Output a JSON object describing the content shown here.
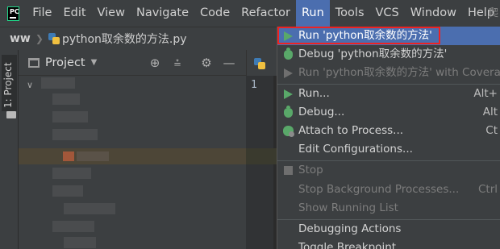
{
  "menubar": {
    "items": [
      "File",
      "Edit",
      "View",
      "Navigate",
      "Code",
      "Refactor",
      "Run",
      "Tools",
      "VCS",
      "Window",
      "Help"
    ],
    "active": "Run",
    "right_text": "爬"
  },
  "breadcrumb": {
    "project": "ww",
    "file": "python取余数的方法.py"
  },
  "left_strip": {
    "tab_label": "1: Project"
  },
  "project_pane": {
    "title": "Project"
  },
  "editor": {
    "line_number": "1"
  },
  "run_menu": {
    "items": [
      {
        "label": "Run 'python取余数的方法'",
        "shortcut": "",
        "icon": "play-icon",
        "state": "selected"
      },
      {
        "label": "Debug 'python取余数的方法'",
        "shortcut": "",
        "icon": "bug-icon",
        "state": "normal"
      },
      {
        "label": "Run 'python取余数的方法' with Coverage",
        "shortcut": "",
        "icon": "coverage-icon",
        "state": "disabled"
      },
      {
        "label": "Run...",
        "shortcut": "Alt+",
        "icon": "play-icon",
        "state": "normal"
      },
      {
        "label": "Debug...",
        "shortcut": "Alt",
        "icon": "bug-icon",
        "state": "normal"
      },
      {
        "label": "Attach to Process...",
        "shortcut": "Ct",
        "icon": "attach-icon",
        "state": "normal"
      },
      {
        "label": "Edit Configurations...",
        "shortcut": "",
        "icon": "",
        "state": "normal"
      },
      {
        "label": "Stop",
        "shortcut": "",
        "icon": "stop-icon",
        "state": "disabled"
      },
      {
        "label": "Stop Background Processes...",
        "shortcut": "Ctrl",
        "icon": "",
        "state": "disabled"
      },
      {
        "label": "Show Running List",
        "shortcut": "",
        "icon": "",
        "state": "disabled"
      },
      {
        "label": "Debugging Actions",
        "shortcut": "",
        "icon": "",
        "state": "normal"
      },
      {
        "label": "Toggle Breakpoint",
        "shortcut": "",
        "icon": "",
        "state": "normal"
      }
    ]
  },
  "colors": {
    "accent": "#4b6eaf",
    "highlight_border": "#ee2222",
    "run_green": "#59a869"
  }
}
